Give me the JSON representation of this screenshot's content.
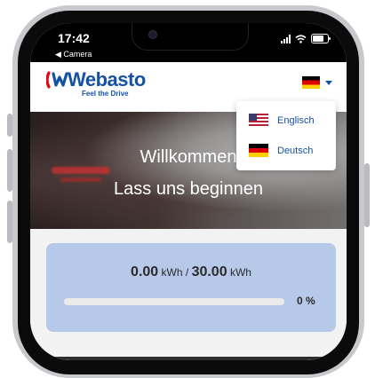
{
  "status_bar": {
    "time": "17:42",
    "back_label": "◀ Camera"
  },
  "header": {
    "logo_text": "Webasto",
    "tagline": "Feel the Drive",
    "selected_language_flag": "flag-de"
  },
  "hero": {
    "title": "Willkommen",
    "subtitle": "Lass uns beginnen"
  },
  "language_dropdown": {
    "items": [
      {
        "label": "Englisch",
        "flag": "flag-us"
      },
      {
        "label": "Deutsch",
        "flag": "flag-de"
      }
    ]
  },
  "charge_card": {
    "current_kwh": "0.00",
    "target_kwh": "30.00",
    "unit": "kWh",
    "separator": "/",
    "percent_label": "0 %",
    "progress_fraction": 0.0
  },
  "colors": {
    "brand_blue": "#1552a6",
    "card_bg": "#b7c9e8"
  }
}
